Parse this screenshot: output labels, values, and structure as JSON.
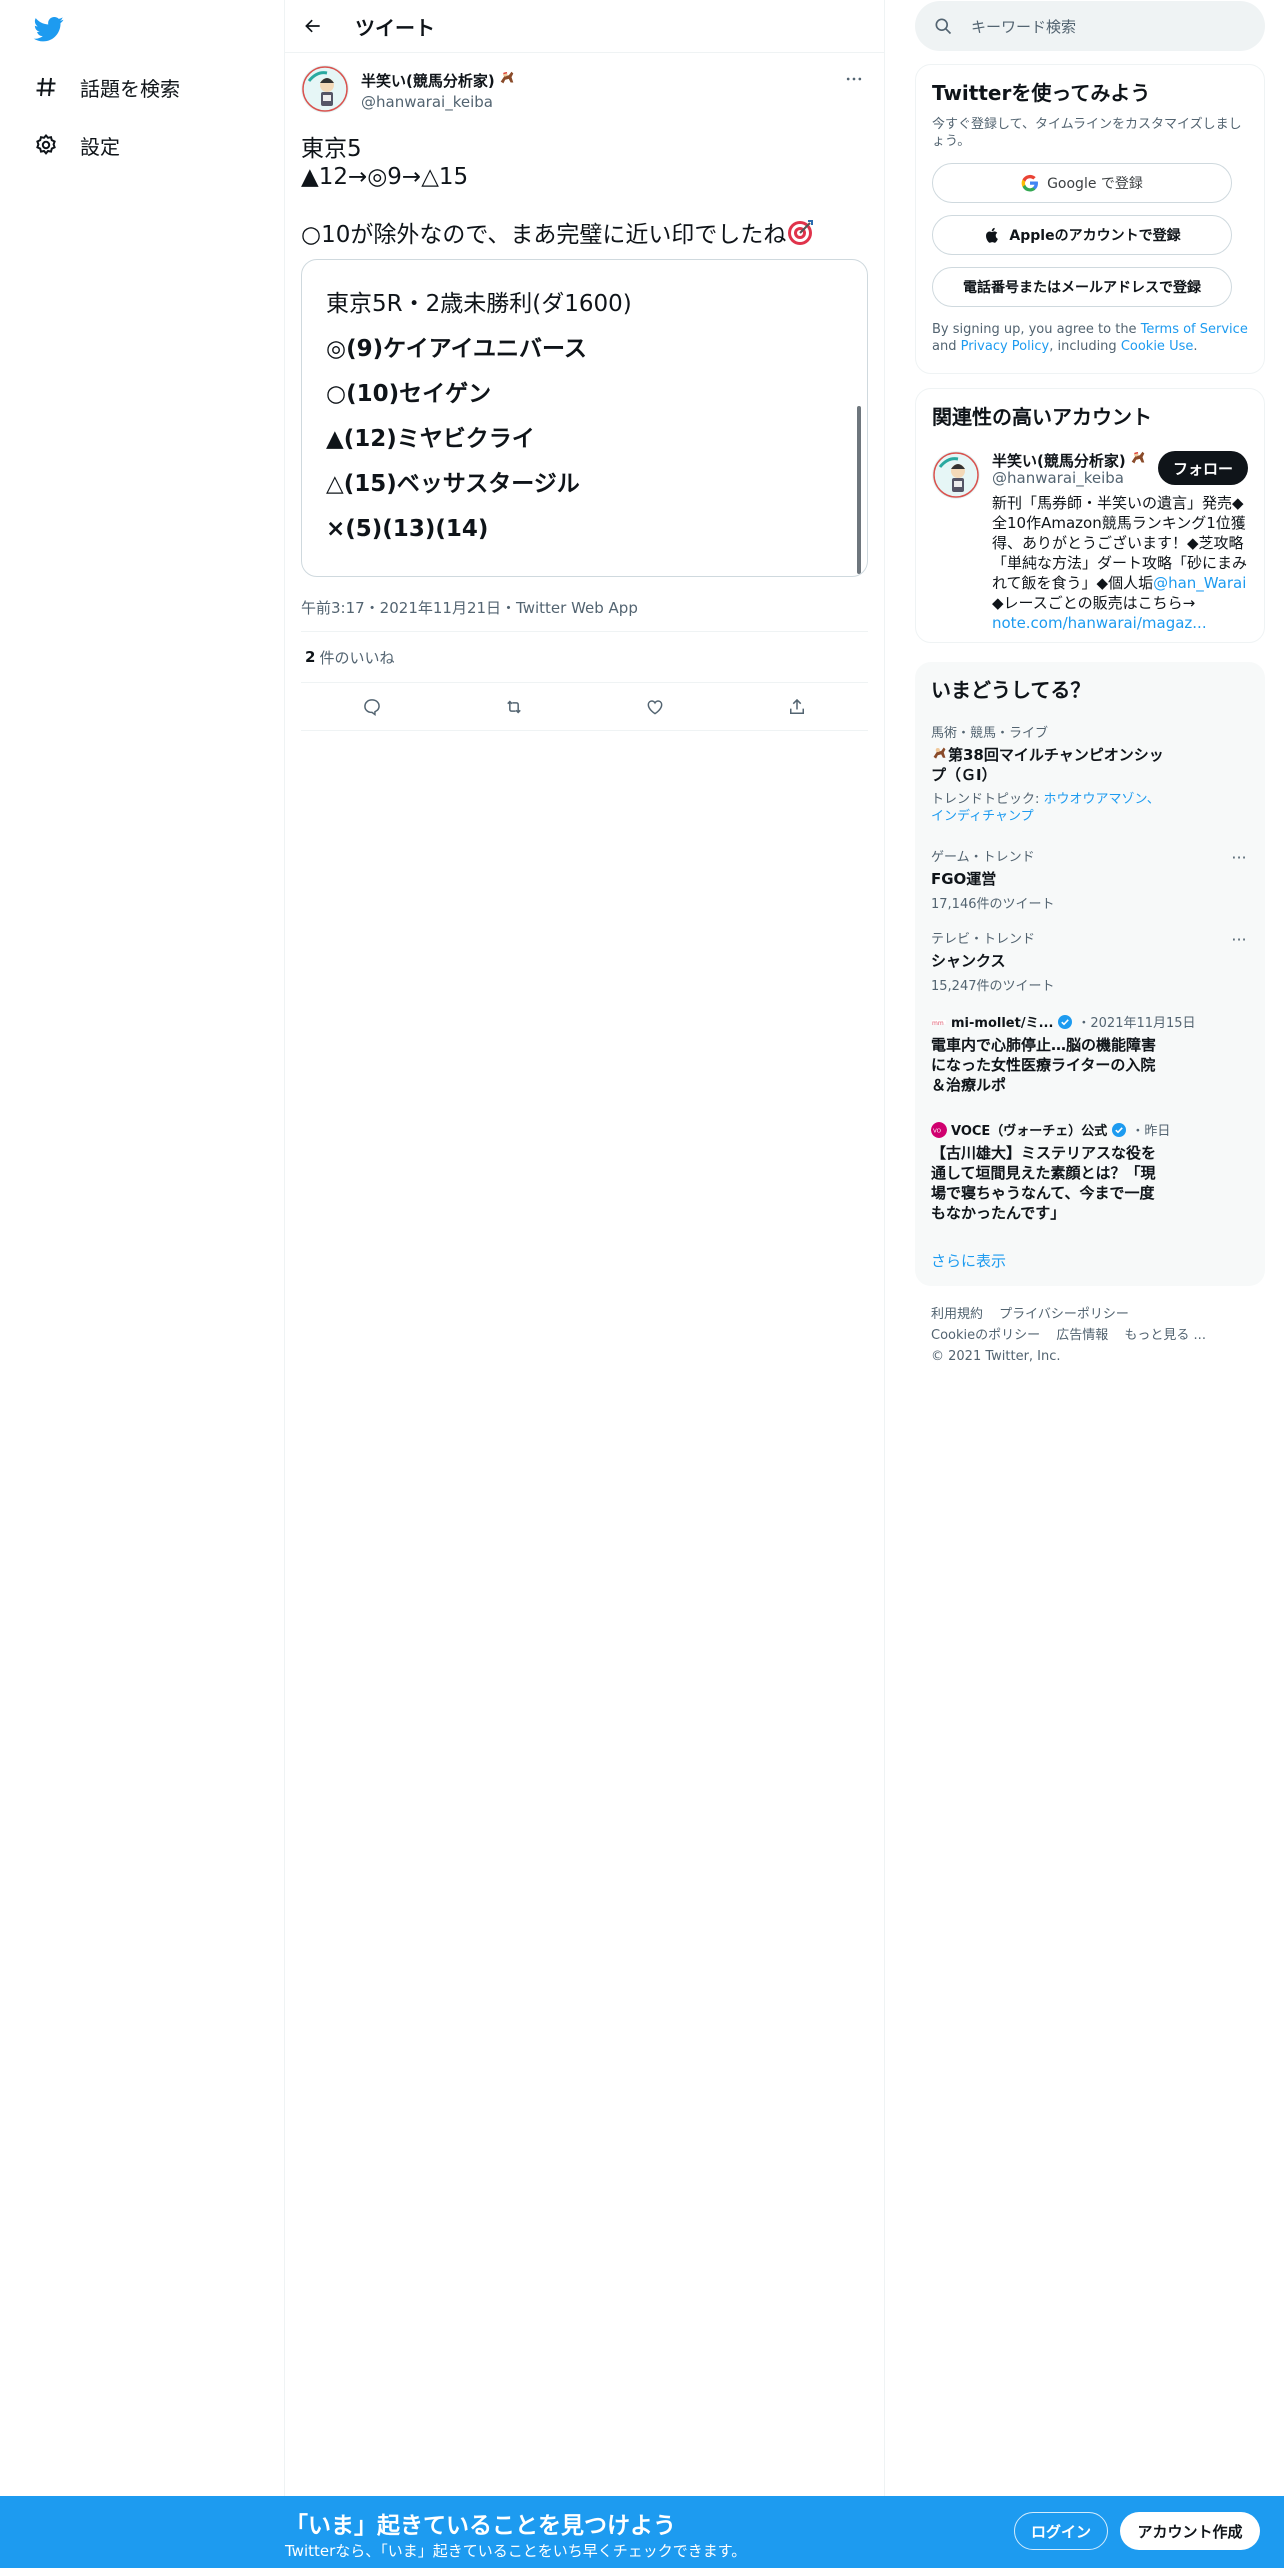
{
  "nav": {
    "explore_label": "話題を検索",
    "settings_label": "設定"
  },
  "header": {
    "title": "ツイート"
  },
  "tweet": {
    "author_name": "半笑い(競馬分析家)",
    "author_handle": "@hanwarai_keiba",
    "text_line1": "東京5",
    "text_line2": "▲12→◎9→△15",
    "text_line3": "○10が除外なので、まあ完璧に近い印でしたね",
    "card_lines": [
      "東京5R・2歳未勝利(ダ1600)",
      "◎(9)ケイアイユニバース",
      "○(10)セイゲン",
      "▲(12)ミヤビクライ",
      "△(15)ベッサスタージル",
      "×(5)(13)(14)"
    ],
    "timestamp": "午前3:17・2021年11月21日・Twitter Web App",
    "likes_count": "2",
    "likes_label": "件のいいね"
  },
  "search": {
    "placeholder": "キーワード検索"
  },
  "signup": {
    "title": "Twitterを使ってみよう",
    "subtitle": "今すぐ登録して、タイムラインをカスタマイズしましょう。",
    "google_label": "Google で登録",
    "apple_label": "Appleのアカウントで登録",
    "phone_label": "電話番号またはメールアドレスで登録",
    "terms_prefix": "By signing up, you agree to the ",
    "terms_link": "Terms of Service",
    "terms_and": " and ",
    "privacy_link": "Privacy Policy",
    "terms_including": ", including ",
    "cookie_link": "Cookie Use",
    "terms_end": "."
  },
  "related": {
    "title": "関連性の高いアカウント",
    "name": "半笑い(競馬分析家)",
    "handle": "@hanwarai_keiba",
    "follow_label": "フォロー",
    "bio": "新刊「馬券師・半笑いの遺言」発売◆全10作Amazon競馬ランキング1位獲得、ありがとうございます！◆芝攻略「単純な方法」ダート攻略「砂にまみれて飯を食う」◆個人垢",
    "bio_mention": "@han_Warai",
    "bio_tail": " ◆レースごとの販売はこちら→ ",
    "bio_link": "note.com/hanwarai/magaz..."
  },
  "trends": {
    "title": "いまどうしてる？",
    "items": [
      {
        "category": "馬術・競馬・ライブ",
        "name": "第38回マイルチャンピオンシップ（ＧⅠ）",
        "topic_prefix": "トレンドトピック: ",
        "topic_links": "ホウオウアマゾン、インディチャンプ"
      },
      {
        "category": "ゲーム・トレンド",
        "name": "FGO運営",
        "count": "17,146件のツイート"
      },
      {
        "category": "テレビ・トレンド",
        "name": "シャンクス",
        "count": "15,247件のツイート"
      }
    ],
    "news": [
      {
        "source": "mi-mollet/ミ...",
        "date": "・2021年11月15日",
        "headline": "電車内で心肺停止…脳の機能障害になった女性医療ライターの入院＆治療ルポ"
      },
      {
        "source": "VOCE（ヴォーチェ）公式",
        "date": "・昨日",
        "headline": "【古川雄大】ミステリアスな役を通して垣間見えた素顔とは？「現場で寝ちゃうなんて、今まで一度もなかったんです」"
      }
    ],
    "show_more": "さらに表示"
  },
  "footer": {
    "links": [
      "利用規約",
      "プライバシーポリシー",
      "Cookieのポリシー",
      "広告情報",
      "もっと見る ..."
    ],
    "copyright": "© 2021 Twitter, Inc."
  },
  "bottom_bar": {
    "title": "「いま」起きていることを見つけよう",
    "subtitle": "Twitterなら、「いま」起きていることをいち早くチェックできます。",
    "login_label": "ログイン",
    "signup_label": "アカウント作成"
  },
  "colors": {
    "accent": "#1d9bf0",
    "text": "#0f1419",
    "secondary": "#536471"
  }
}
